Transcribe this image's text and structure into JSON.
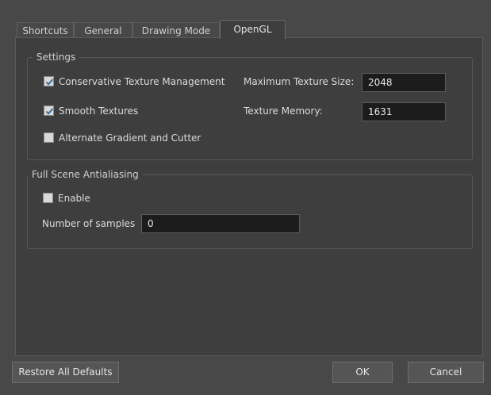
{
  "tabs": [
    {
      "label": "Shortcuts",
      "active": false
    },
    {
      "label": "General",
      "active": false
    },
    {
      "label": "Drawing Mode",
      "active": false
    },
    {
      "label": "OpenGL",
      "active": true
    }
  ],
  "settings": {
    "title": "Settings",
    "conservative_texture_management": {
      "label": "Conservative Texture Management",
      "checked": true
    },
    "smooth_textures": {
      "label": "Smooth Textures",
      "checked": true
    },
    "alternate_gradient": {
      "label": "Alternate Gradient and Cutter",
      "checked": false
    },
    "max_texture_size": {
      "label": "Maximum Texture Size:",
      "value": "2048"
    },
    "texture_memory": {
      "label": "Texture Memory:",
      "value": "1631"
    }
  },
  "antialiasing": {
    "title": "Full Scene Antialiasing",
    "enable": {
      "label": "Enable",
      "checked": false
    },
    "samples": {
      "label": "Number of samples",
      "value": "0"
    }
  },
  "buttons": {
    "restore": "Restore All Defaults",
    "ok": "OK",
    "cancel": "Cancel"
  },
  "colors": {
    "background": "#484848",
    "panel": "#3e3e3e",
    "input_bg": "#1c1c1c",
    "checkmark": "#3a6ea5"
  }
}
